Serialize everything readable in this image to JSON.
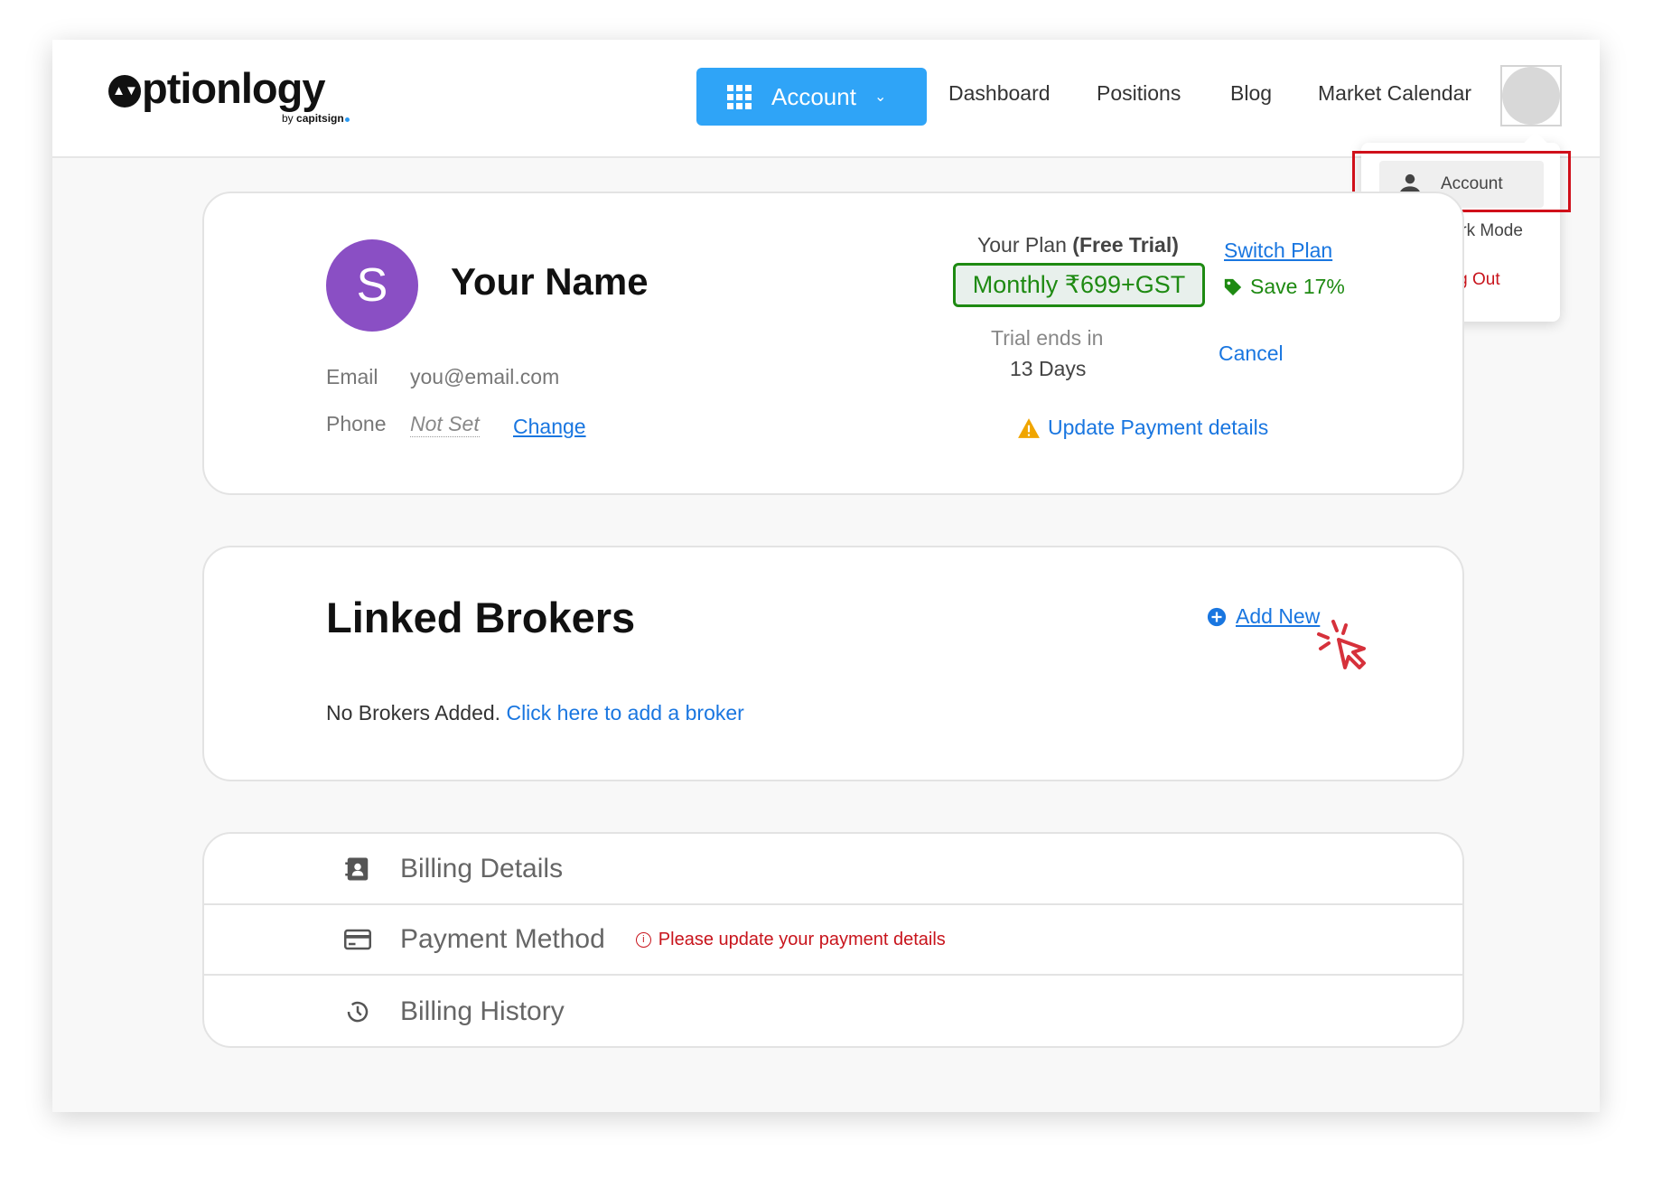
{
  "header": {
    "logo": "ptionlogy",
    "byline_prefix": "by",
    "byline_brand": "capitsign",
    "account_button": "Account",
    "nav": [
      "Dashboard",
      "Positions",
      "Blog",
      "Market Calendar"
    ]
  },
  "dropdown": {
    "items": [
      {
        "label": "Account",
        "icon": "person-icon"
      },
      {
        "label": "Dark Mode",
        "icon": "moon-icon"
      },
      {
        "label": "Log Out",
        "icon": "logout-icon"
      }
    ]
  },
  "profile": {
    "initial": "S",
    "name": "Your Name",
    "email_label": "Email",
    "email": "you@email.com",
    "phone_label": "Phone",
    "phone": "Not Set",
    "change": "Change"
  },
  "plan": {
    "label": "Your Plan",
    "type": "(Free Trial)",
    "price": "Monthly ₹699+GST",
    "switch": "Switch Plan",
    "save": "Save 17%",
    "trial_label": "Trial ends in",
    "trial_days": "13 Days",
    "cancel": "Cancel",
    "update_payment": "Update Payment details"
  },
  "brokers": {
    "title": "Linked Brokers",
    "add_new": "Add New",
    "empty_text": "No Brokers Added.",
    "empty_link": "Click here to add a broker"
  },
  "billing": {
    "rows": [
      {
        "label": "Billing Details",
        "icon": "contact-book-icon"
      },
      {
        "label": "Payment Method",
        "icon": "credit-card-icon",
        "warning": "Please update your payment details"
      },
      {
        "label": "Billing History",
        "icon": "history-icon"
      }
    ]
  },
  "colors": {
    "accent": "#2fa4f7",
    "link": "#1976e0",
    "green": "#1e8a12",
    "error": "#c8141c",
    "avatar": "#8a4fc4",
    "highlight": "#d0101a"
  }
}
